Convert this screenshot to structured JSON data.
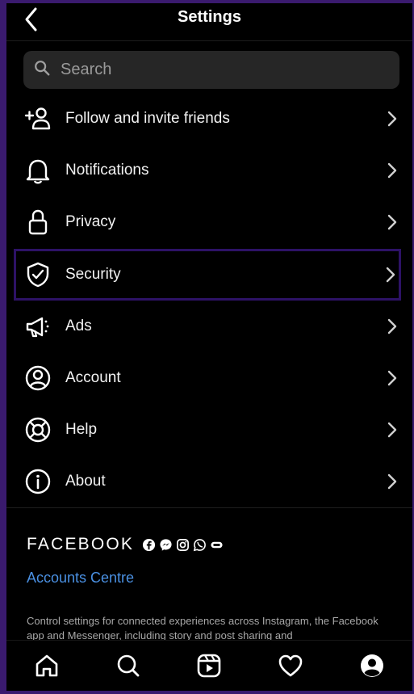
{
  "header": {
    "title": "Settings"
  },
  "search": {
    "placeholder": "Search"
  },
  "menu": [
    {
      "label": "Follow and invite friends",
      "icon": "add-person-icon"
    },
    {
      "label": "Notifications",
      "icon": "bell-icon"
    },
    {
      "label": "Privacy",
      "icon": "lock-icon"
    },
    {
      "label": "Security",
      "icon": "shield-icon"
    },
    {
      "label": "Ads",
      "icon": "megaphone-icon"
    },
    {
      "label": "Account",
      "icon": "account-circle-icon"
    },
    {
      "label": "Help",
      "icon": "lifebuoy-icon"
    },
    {
      "label": "About",
      "icon": "info-icon"
    }
  ],
  "facebook": {
    "wordmark": "FACEBOOK",
    "accounts_centre": "Accounts Centre",
    "description": "Control settings for connected experiences across Instagram, the Facebook app and Messenger, including story and post sharing and"
  },
  "tabbar": [
    "home-icon",
    "search-icon",
    "reels-icon",
    "heart-icon",
    "profile-icon"
  ],
  "colors": {
    "background": "#000000",
    "selection_border": "#2d1266",
    "link": "#4a90e2",
    "search_bg": "#262626"
  }
}
